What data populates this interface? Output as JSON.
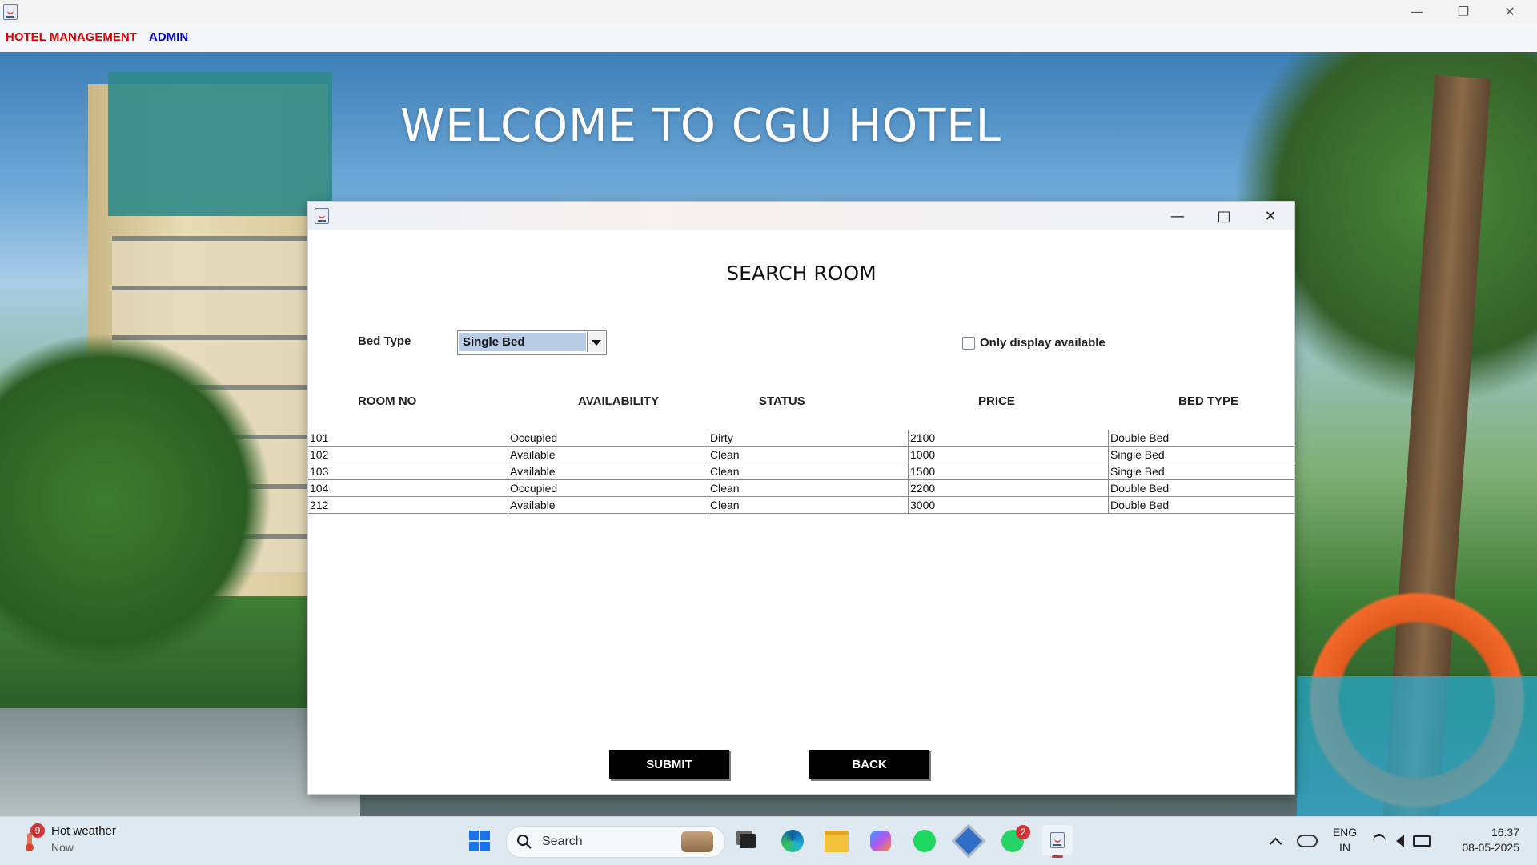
{
  "window": {
    "minimize_icon": "minimize-icon",
    "restore_icon": "restore-icon",
    "close_icon": "close-icon"
  },
  "menubar": {
    "items": [
      {
        "label": "HOTEL MANAGEMENT",
        "color": "#e00000"
      },
      {
        "label": "ADMIN",
        "color": "#0000e0"
      }
    ]
  },
  "background": {
    "welcome_text": "WELCOME TO CGU HOTEL"
  },
  "dialog": {
    "title": "SEARCH ROOM",
    "bed_type_label": "Bed Type",
    "bed_type_selected": "Single Bed",
    "only_available_label": "Only display available",
    "only_available_checked": false,
    "columns": [
      "ROOM NO",
      "AVAILABILITY",
      "STATUS",
      "PRICE",
      "BED TYPE"
    ],
    "rows": [
      [
        "101",
        "Occupied",
        "Dirty",
        "2100",
        "Double Bed"
      ],
      [
        "102",
        "Available",
        "Clean",
        "1000",
        "Single Bed"
      ],
      [
        "103",
        "Available",
        "Clean",
        "1500",
        "Single Bed"
      ],
      [
        "104",
        "Occupied",
        "Clean",
        "2200",
        "Double Bed"
      ],
      [
        "212",
        "Available",
        "Clean",
        "3000",
        "Double Bed"
      ]
    ],
    "submit_label": "SUBMIT",
    "back_label": "BACK"
  },
  "taskbar": {
    "weather_title": "Hot weather",
    "weather_sub": "Now",
    "weather_badge": "9",
    "search_placeholder": "Search",
    "whatsapp_badge": "2",
    "lang_line1": "ENG",
    "lang_line2": "IN",
    "time": "16:37",
    "date": "08-05-2025"
  }
}
